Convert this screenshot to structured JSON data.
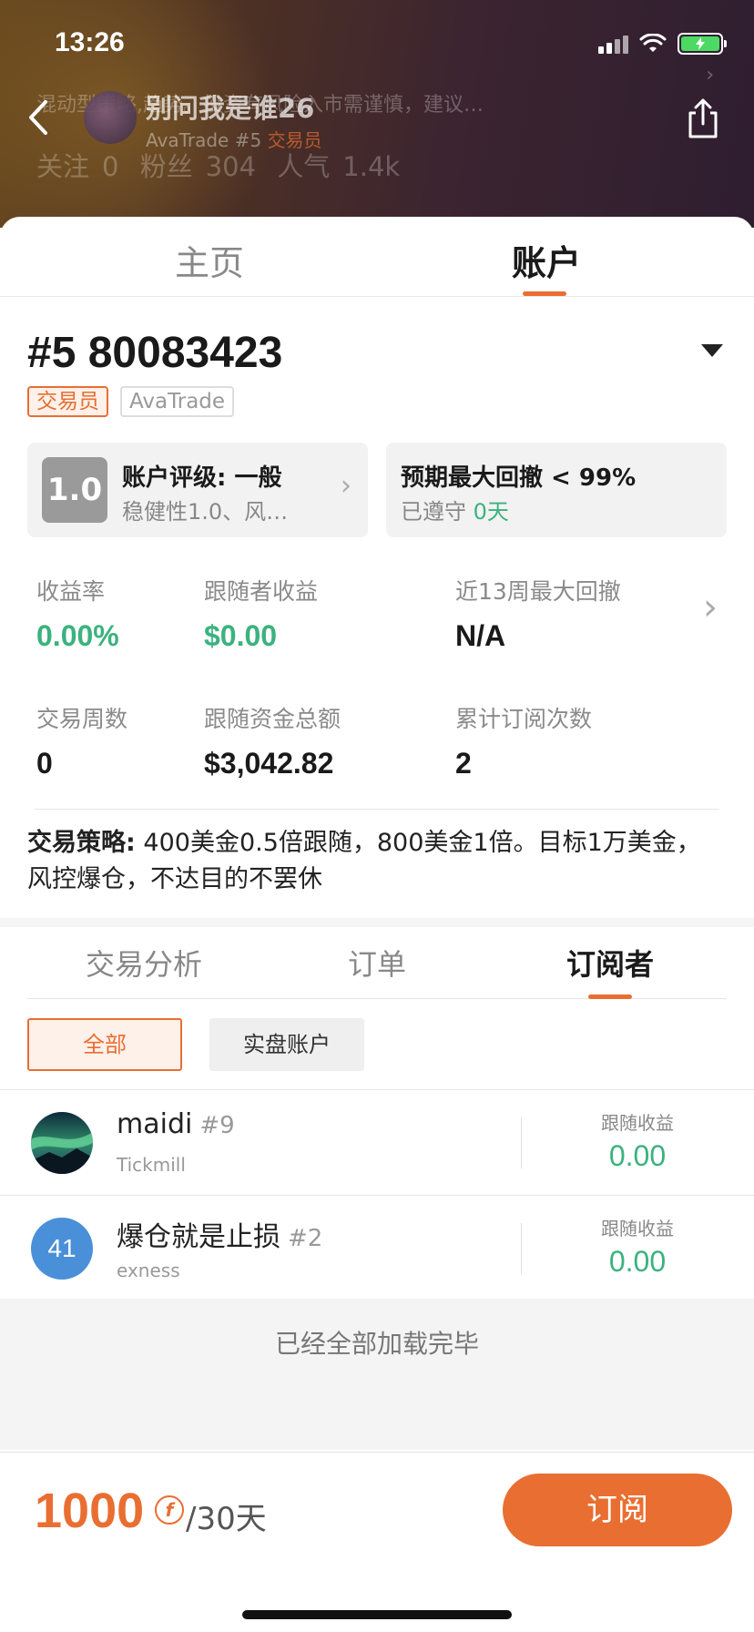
{
  "status_bar": {
    "time": "13:26"
  },
  "header": {
    "strategy_preview": "混动型策略,趋势。投资有风险入市需谨慎，建议…",
    "name": "别问我是谁26",
    "sub_broker": "AvaTrade #5",
    "sub_role": "交易员",
    "follow_label": "关注",
    "follow_value": "0",
    "fans_label": "粉丝",
    "fans_value": "304",
    "popularity_label": "人气",
    "popularity_value": "1.4k"
  },
  "top_tabs": [
    "主页",
    "账户"
  ],
  "account": {
    "title": "#5 80083423",
    "role_tag": "交易员",
    "broker_tag": "AvaTrade"
  },
  "cards": {
    "rating_score": "1.0",
    "rating_title": "账户评级: 一般",
    "rating_sub": "稳健性1.0、风…",
    "drawdown_title": "预期最大回撤 < 99%",
    "drawdown_sub_prefix": "已遵守",
    "drawdown_sub_value": "0天"
  },
  "metrics": [
    {
      "label": "收益率",
      "value": "0.00%"
    },
    {
      "label": "跟随者收益",
      "value": "$0.00"
    },
    {
      "label": "近13周最大回撤",
      "value": "N/A"
    },
    {
      "label": "交易周数",
      "value": "0"
    },
    {
      "label": "跟随资金总额",
      "value": "$3,042.82"
    },
    {
      "label": "累计订阅次数",
      "value": "2"
    }
  ],
  "strategy": {
    "label": "交易策略:",
    "text": "400美金0.5倍跟随，800美金1倍。目标1万美金，风控爆仓，不达目的不罢休"
  },
  "sub_tabs": [
    "交易分析",
    "订单",
    "订阅者"
  ],
  "filters": [
    "全部",
    "实盘账户"
  ],
  "subscribers": [
    {
      "name": "maidi",
      "rank": "#9",
      "broker": "Tickmill",
      "profit_label": "跟随收益",
      "profit": "0.00"
    },
    {
      "name": "爆仓就是止损",
      "rank": "#2",
      "broker": "exness",
      "profit_label": "跟随收益",
      "profit": "0.00",
      "avatar_text": "41"
    }
  ],
  "loaded_text": "已经全部加载完毕",
  "footer": {
    "price": "1000",
    "coin_symbol": "f",
    "period": "/30天",
    "subscribe_label": "订阅"
  },
  "colors": {
    "accent": "#e96e32",
    "positive": "#3cb27f"
  }
}
